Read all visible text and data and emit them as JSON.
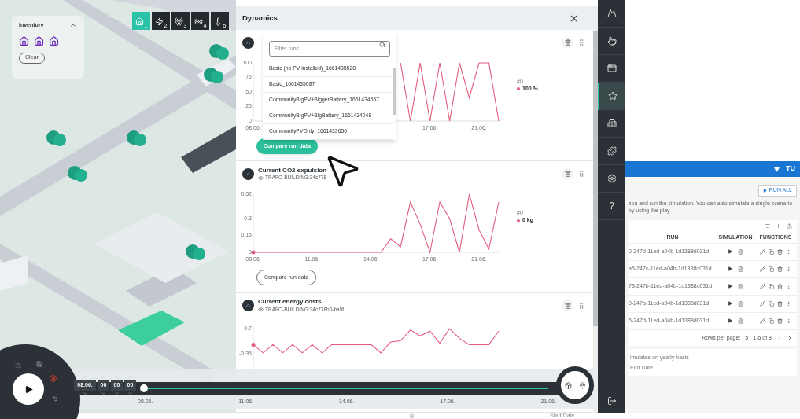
{
  "map": {
    "inventory": {
      "title": "Inventory",
      "expanded": true,
      "clear_button": "Clear"
    },
    "layer_buttons": [
      {
        "number": "1",
        "selected": true
      },
      {
        "number": "2",
        "selected": false
      },
      {
        "number": "3",
        "selected": false
      },
      {
        "number": "4",
        "selected": false
      },
      {
        "number": "5",
        "selected": false
      }
    ]
  },
  "dynamics": {
    "title": "Dynamics",
    "run_filter": {
      "placeholder": "Filter runs",
      "runs": [
        {
          "label": "Basic (no PV installed)_1661435528",
          "selected": false
        },
        {
          "label": "Basic_1661435087",
          "selected": false
        },
        {
          "label": "CommunityBigPV+BiggerBattery_1661434567",
          "selected": false
        },
        {
          "label": "CommunityBigPV+BigBattery_1661434048",
          "selected": false
        },
        {
          "label": "CommunityPVOnly_1661433656",
          "selected": false
        }
      ]
    },
    "cards": [
      {
        "expanded": true,
        "legend_value": "100 %",
        "compare_button": "Compare run data",
        "compare_hovered": true,
        "chart_data": {
          "type": "line",
          "categories": [
            "08.06.",
            null,
            null,
            null,
            null,
            null,
            null,
            null,
            null,
            null,
            null,
            null,
            null,
            null,
            null,
            null,
            null,
            null,
            "17.06.",
            null,
            null,
            null,
            null,
            "21.06.",
            null,
            null
          ],
          "ylim": [
            0,
            100
          ],
          "yticks": [
            0,
            25,
            50,
            75,
            100
          ],
          "series": [
            {
              "name": "#0",
              "color": "#e05a7a",
              "values": [
                null,
                null,
                null,
                null,
                null,
                null,
                null,
                null,
                null,
                null,
                null,
                null,
                null,
                null,
                null,
                100,
                0,
                100,
                0,
                100,
                0,
                100,
                40,
                100,
                100,
                0
              ]
            }
          ]
        }
      },
      {
        "expanded": true,
        "title": "Current CO2 expulsion",
        "subtitle": "TRAFO-BUILDING:34c778",
        "legend_value": "0 kg",
        "compare_button": "Compare run data",
        "compare_hovered": false,
        "chart_data": {
          "type": "line",
          "categories": [
            "08.06.",
            null,
            null,
            null,
            null,
            null,
            "11.06.",
            null,
            null,
            null,
            null,
            null,
            "14.06.",
            null,
            null,
            null,
            null,
            null,
            "17.06.",
            null,
            null,
            null,
            null,
            "21.06.",
            null,
            null
          ],
          "ylim": [
            0,
            0.52
          ],
          "yticks": [
            0,
            0.15,
            0.3,
            0.52
          ],
          "series": [
            {
              "name": "#0",
              "color": "#e05a7a",
              "values": [
                0,
                0,
                0,
                0,
                0,
                0,
                0,
                0,
                0,
                0,
                0,
                0,
                0,
                0,
                0.12,
                0.05,
                0.45,
                0.25,
                0,
                0.45,
                0.3,
                0,
                0.52,
                0.2,
                0.03,
                0.45
              ]
            }
          ]
        }
      },
      {
        "expanded": true,
        "title": "Current energy costs",
        "subtitle": "TRAFO-BUILDING:34c778b0-ba5f...",
        "chart_data": {
          "type": "line",
          "categories": [
            null,
            null,
            null,
            null,
            null,
            null,
            null,
            null,
            null,
            null,
            null,
            null,
            null,
            null,
            null,
            null,
            null,
            null,
            null,
            null,
            null,
            null,
            null,
            null,
            null,
            null
          ],
          "ylim": [
            -1.6,
            0.8
          ],
          "yticks": [
            -0.35,
            0.7
          ],
          "series": [
            {
              "color": "#e05a7a",
              "values": [
                0.04,
                -0.3,
                0.04,
                -0.3,
                0.04,
                -0.3,
                0.04,
                -0.3,
                0.04,
                0.04,
                0.04,
                0.04,
                0.04,
                -0.3,
                0.15,
                0.2,
                0.65,
                0.4,
                0.6,
                0.1,
                0.7,
                0.3,
                0.04,
                0.04,
                0.04,
                0.6
              ]
            }
          ]
        }
      }
    ]
  },
  "timeline": {
    "date": "08.06.",
    "hours": "00",
    "minutes": "00",
    "seconds": "00",
    "level": 0,
    "ticks": [
      "08.06.",
      "11.06.",
      "14.06.",
      "17.06.",
      "21.06."
    ]
  },
  "sidebar": {
    "items": [
      {
        "selected": false
      },
      {
        "selected": false
      },
      {
        "selected": false
      },
      {
        "selected": true
      },
      {
        "selected": false
      },
      {
        "selected": false
      },
      {
        "selected": false
      },
      {
        "label": "?",
        "selected": false
      }
    ]
  },
  "scenario_app": {
    "logo": "TU",
    "run_all_button": "RUN ALL",
    "description": "zon and run the simulation. You can also simulate a single scenario by using the play",
    "table": {
      "columns": [
        "RUN",
        "SIMULATION",
        "FUNCTIONS"
      ],
      "rows": [
        {
          "run": "0-247d-11ed-a04b-1d1388d031d"
        },
        {
          "run": "a5-247c-11ed-a04b-1d1388d031d"
        },
        {
          "run": "73-247b-11ed-a04b-1d1388d031d"
        },
        {
          "run": "0-247a-11ed-a04b-1d1388d031d"
        },
        {
          "run": "6-247d-11ed-a04b-1d1388d031d"
        }
      ]
    },
    "rows_per_page_label": "Rows per page:",
    "rows_per_page": "5",
    "range": "1-5 of 8",
    "note": "imulates on yearly basis",
    "end_date_label": "End Date",
    "start_date_label": "Start Date"
  }
}
